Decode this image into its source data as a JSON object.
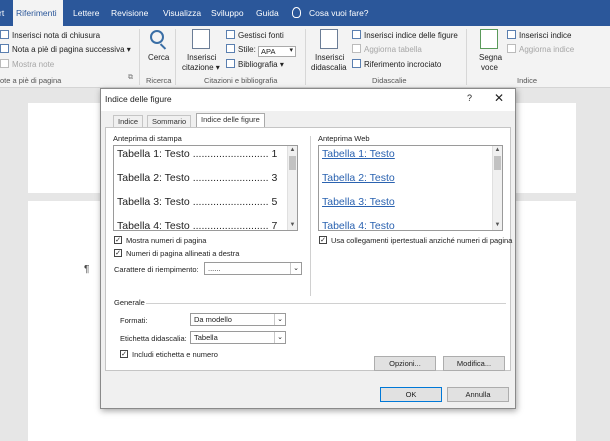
{
  "tabs": [
    {
      "label": "rt"
    },
    {
      "label": "Riferimenti"
    },
    {
      "label": "Lettere"
    },
    {
      "label": "Revisione"
    },
    {
      "label": "Visualizza"
    },
    {
      "label": "Sviluppo"
    },
    {
      "label": "Guida"
    }
  ],
  "tell_me": "Cosa vuoi fare?",
  "ribbon": {
    "footnotes": {
      "insert_endnote": "Inserisci nota di chiusura",
      "next_footnote": "Nota a piè di pagina successiva",
      "show_notes": "Mostra note",
      "group_label": "ote a piè di pagina"
    },
    "research": {
      "search": "Cerca",
      "group_label": "Ricerca"
    },
    "citations": {
      "insert_citation": "Inserisci citazione",
      "manage_sources": "Gestisci fonti",
      "style_label": "Stile:",
      "style_value": "APA",
      "bibliography": "Bibliografia",
      "group_label": "Citazioni e bibliografia"
    },
    "captions": {
      "insert_caption": "Inserisci didascalia",
      "insert_table_of_figures": "Inserisci indice delle figure",
      "update_table": "Aggiorna tabella",
      "cross_reference": "Riferimento incrociato",
      "group_label": "Didascalie"
    },
    "index": {
      "mark_entry": "Segna voce",
      "insert_index": "Inserisci indice",
      "update_index": "Aggiorna indice",
      "group_label": "Indice"
    }
  },
  "dialog": {
    "title": "Indice delle figure",
    "help": "?",
    "close": "✕",
    "tabs": [
      "Indice",
      "Sommario",
      "Indice delle figure"
    ],
    "print_preview": {
      "label": "Anteprima di stampa",
      "lines": [
        {
          "text": "Tabella 1: Testo",
          "dots": "..........................",
          "page": "1"
        },
        {
          "text": "Tabella 2: Testo",
          "dots": "..........................",
          "page": "3"
        },
        {
          "text": "Tabella 3: Testo",
          "dots": "..........................",
          "page": "5"
        },
        {
          "text": "Tabella 4: Testo",
          "dots": "..........................",
          "page": "7"
        }
      ]
    },
    "web_preview": {
      "label": "Anteprima Web",
      "lines": [
        "Tabella 1: Testo",
        "Tabella 2: Testo",
        "Tabella 3: Testo",
        "Tabella 4: Testo"
      ]
    },
    "show_page_numbers": {
      "label": "Mostra numeri di pagina",
      "checked": true
    },
    "right_align": {
      "label": "Numeri di pagina allineati a destra",
      "checked": true
    },
    "use_hyperlinks": {
      "label": "Usa collegamenti ipertestuali anziché numeri di pagina",
      "checked": true
    },
    "tab_leader": {
      "label": "Carattere di riempimento:",
      "value": "......"
    },
    "general": {
      "label": "Generale",
      "formats": {
        "label": "Formati:",
        "value": "Da modello"
      },
      "caption_label": {
        "label": "Etichetta didascalia:",
        "value": "Tabella"
      },
      "include_label": {
        "label": "Includi etichetta e numero",
        "checked": true
      }
    },
    "buttons": {
      "options": "Opzioni...",
      "modify": "Modifica...",
      "ok": "OK",
      "cancel": "Annulla"
    }
  },
  "document": {
    "pilcrow": "¶"
  }
}
